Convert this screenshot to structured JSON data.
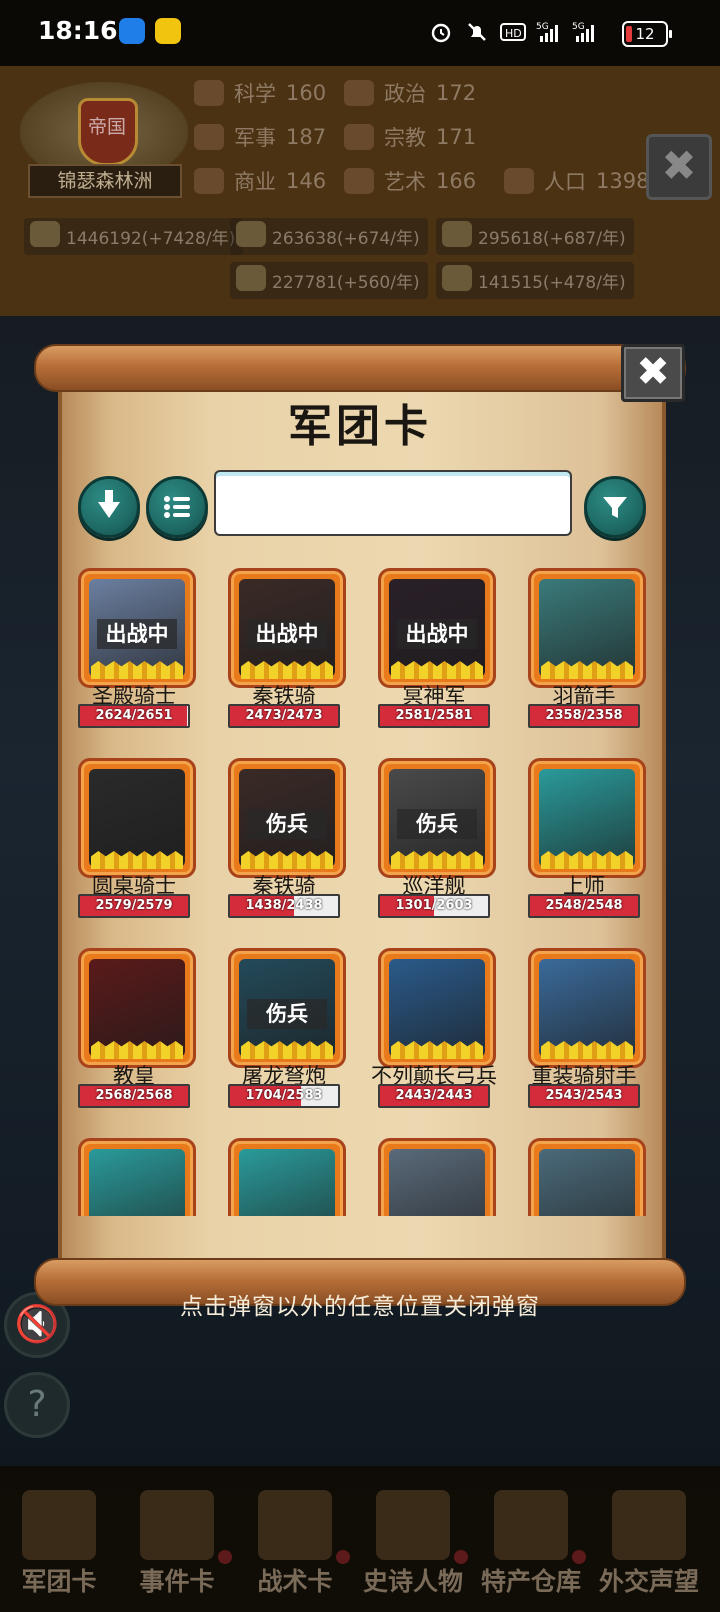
{
  "status_bar": {
    "time": "18:16",
    "battery": "12",
    "icons": [
      "alarm-icon",
      "mute-icon",
      "hd-icon",
      "5g-signal-icon",
      "5g-signal-icon"
    ]
  },
  "empire": {
    "emblem_title": "帝国",
    "name": "锦瑟森林洲",
    "stats": [
      {
        "label": "科学",
        "value": "160"
      },
      {
        "label": "政治",
        "value": "172"
      },
      {
        "label": "军事",
        "value": "187"
      },
      {
        "label": "宗教",
        "value": "171"
      },
      {
        "label": "商业",
        "value": "146"
      },
      {
        "label": "艺术",
        "value": "166"
      },
      {
        "label": "人口",
        "value": "1398"
      }
    ],
    "resources": [
      "1446192(+7428/年)",
      "263638(+674/年)",
      "295618(+687/年)",
      "227781(+560/年)",
      "141515(+478/年)"
    ]
  },
  "modal": {
    "title": "军团卡",
    "close_symbol": "✖",
    "search": {
      "value": "",
      "placeholder": ""
    },
    "cards": [
      {
        "name": "圣殿骑士",
        "hp": "2624/2651",
        "hp_ratio": 0.99,
        "status": "出战中",
        "art": "#6b7fa0"
      },
      {
        "name": "秦铁骑",
        "hp": "2473/2473",
        "hp_ratio": 1.0,
        "status": "出战中",
        "art": "#3a2a26"
      },
      {
        "name": "冥神军",
        "hp": "2581/2581",
        "hp_ratio": 1.0,
        "status": "出战中",
        "art": "#2a2028"
      },
      {
        "name": "羽箭手",
        "hp": "2358/2358",
        "hp_ratio": 1.0,
        "status": "",
        "art": "#3a7a7a"
      },
      {
        "name": "圆桌骑士",
        "hp": "2579/2579",
        "hp_ratio": 1.0,
        "status": "",
        "art": "#2a2a2a"
      },
      {
        "name": "秦铁骑",
        "hp": "1438/2438",
        "hp_ratio": 0.59,
        "status": "伤兵",
        "art": "#3a2a26"
      },
      {
        "name": "巡洋舰",
        "hp": "1301/2603",
        "hp_ratio": 0.5,
        "status": "伤兵",
        "art": "#4a4a4a"
      },
      {
        "name": "上师",
        "hp": "2548/2548",
        "hp_ratio": 1.0,
        "status": "",
        "art": "#2a9a9a"
      },
      {
        "name": "教皇",
        "hp": "2568/2568",
        "hp_ratio": 1.0,
        "status": "",
        "art": "#5a1a1a"
      },
      {
        "name": "屠龙弩炮",
        "hp": "1704/2583",
        "hp_ratio": 0.66,
        "status": "伤兵",
        "art": "#234a5a"
      },
      {
        "name": "不列颠长弓兵",
        "hp": "2443/2443",
        "hp_ratio": 1.0,
        "status": "",
        "art": "#2a5a8a"
      },
      {
        "name": "重装骑射手",
        "hp": "2543/2543",
        "hp_ratio": 1.0,
        "status": "",
        "art": "#3a6a9a"
      },
      {
        "name": "",
        "hp": "",
        "hp_ratio": 1.0,
        "status": "",
        "art": "#2a9a9a"
      },
      {
        "name": "",
        "hp": "",
        "hp_ratio": 1.0,
        "status": "",
        "art": "#2a9a9a"
      },
      {
        "name": "",
        "hp": "",
        "hp_ratio": 1.0,
        "status": "",
        "art": "#5a6a7a"
      },
      {
        "name": "",
        "hp": "",
        "hp_ratio": 1.0,
        "status": "",
        "art": "#4a6a7a"
      }
    ]
  },
  "hint": "点击弹窗以外的任意位置关闭弹窗",
  "bottom_nav": [
    "军团卡",
    "事件卡",
    "战术卡",
    "史诗人物",
    "特产仓库",
    "外交声望"
  ],
  "colors": {
    "accent_teal": "#1f6b66",
    "card_frame": "#e87a1c",
    "hp_red": "#d42c3a"
  }
}
